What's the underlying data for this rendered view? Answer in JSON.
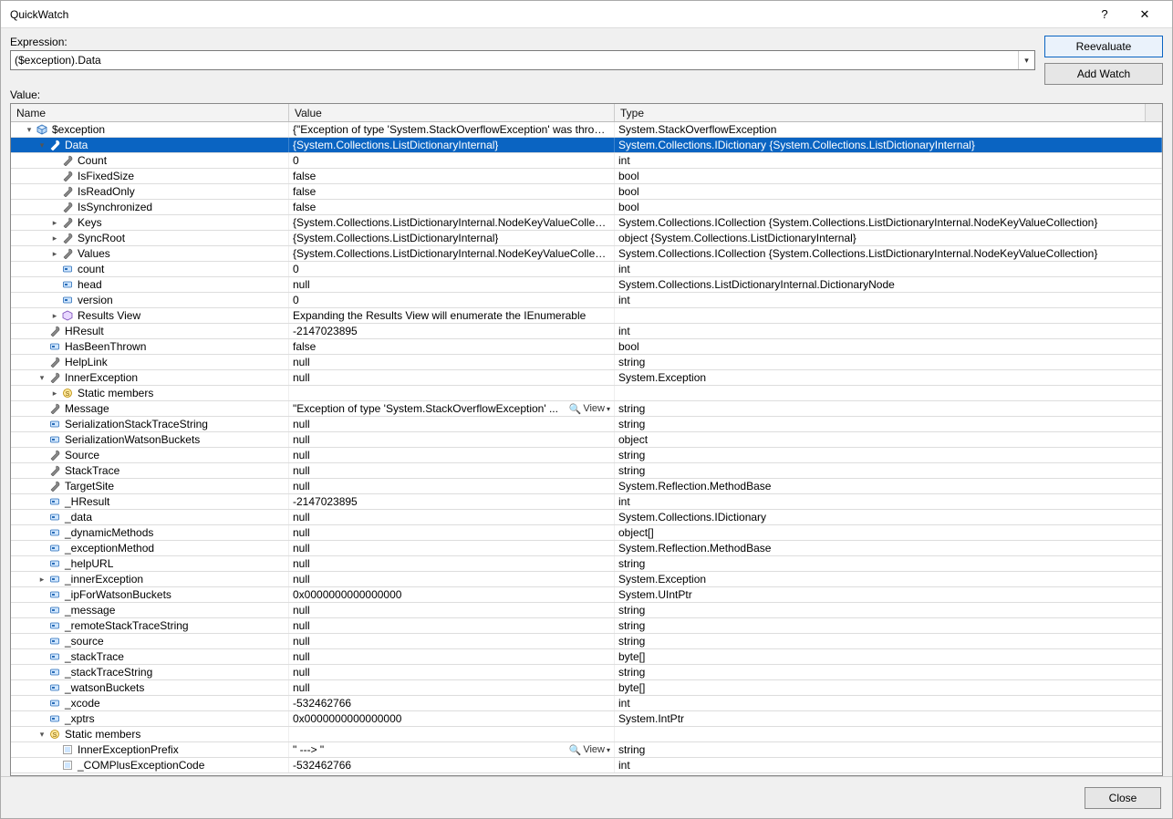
{
  "window": {
    "title": "QuickWatch",
    "help_btn": "?",
    "close_btn": "✕"
  },
  "labels": {
    "expression": "Expression:",
    "value": "Value:"
  },
  "expression": {
    "text": "($exception).Data"
  },
  "buttons": {
    "reevaluate": "Reevaluate",
    "add_watch": "Add Watch",
    "close": "Close"
  },
  "columns": {
    "name": "Name",
    "value": "Value",
    "type": "Type"
  },
  "visualizer": {
    "view_label": "View"
  },
  "rows": [
    {
      "depth": 1,
      "expander": "open",
      "icon": "cube",
      "name": "$exception",
      "value": "{\"Exception of type 'System.StackOverflowException' was thrown...",
      "type": "System.StackOverflowException",
      "selected": false
    },
    {
      "depth": 2,
      "expander": "open",
      "icon": "wrench",
      "name": "Data",
      "value": "{System.Collections.ListDictionaryInternal}",
      "type": "System.Collections.IDictionary {System.Collections.ListDictionaryInternal}",
      "selected": true
    },
    {
      "depth": 3,
      "expander": "none",
      "icon": "wrench",
      "name": "Count",
      "value": "0",
      "type": "int"
    },
    {
      "depth": 3,
      "expander": "none",
      "icon": "wrench",
      "name": "IsFixedSize",
      "value": "false",
      "type": "bool"
    },
    {
      "depth": 3,
      "expander": "none",
      "icon": "wrench",
      "name": "IsReadOnly",
      "value": "false",
      "type": "bool"
    },
    {
      "depth": 3,
      "expander": "none",
      "icon": "wrench",
      "name": "IsSynchronized",
      "value": "false",
      "type": "bool"
    },
    {
      "depth": 3,
      "expander": "closed",
      "icon": "wrench",
      "name": "Keys",
      "value": "{System.Collections.ListDictionaryInternal.NodeKeyValueCollecti...",
      "type": "System.Collections.ICollection {System.Collections.ListDictionaryInternal.NodeKeyValueCollection}"
    },
    {
      "depth": 3,
      "expander": "closed",
      "icon": "wrench",
      "name": "SyncRoot",
      "value": "{System.Collections.ListDictionaryInternal}",
      "type": "object {System.Collections.ListDictionaryInternal}"
    },
    {
      "depth": 3,
      "expander": "closed",
      "icon": "wrench",
      "name": "Values",
      "value": "{System.Collections.ListDictionaryInternal.NodeKeyValueCollecti...",
      "type": "System.Collections.ICollection {System.Collections.ListDictionaryInternal.NodeKeyValueCollection}"
    },
    {
      "depth": 3,
      "expander": "none",
      "icon": "field",
      "name": "count",
      "value": "0",
      "type": "int"
    },
    {
      "depth": 3,
      "expander": "none",
      "icon": "field",
      "name": "head",
      "value": "null",
      "type": "System.Collections.ListDictionaryInternal.DictionaryNode"
    },
    {
      "depth": 3,
      "expander": "none",
      "icon": "field",
      "name": "version",
      "value": "0",
      "type": "int"
    },
    {
      "depth": 3,
      "expander": "closed",
      "icon": "results",
      "name": "Results View",
      "value": "Expanding the Results View will enumerate the IEnumerable",
      "type": ""
    },
    {
      "depth": 2,
      "expander": "none",
      "icon": "wrench",
      "name": "HResult",
      "value": "-2147023895",
      "type": "int"
    },
    {
      "depth": 2,
      "expander": "none",
      "icon": "field",
      "name": "HasBeenThrown",
      "value": "false",
      "type": "bool"
    },
    {
      "depth": 2,
      "expander": "none",
      "icon": "wrench",
      "name": "HelpLink",
      "value": "null",
      "type": "string"
    },
    {
      "depth": 2,
      "expander": "open",
      "icon": "wrench",
      "name": "InnerException",
      "value": "null",
      "type": "System.Exception"
    },
    {
      "depth": 3,
      "expander": "closed",
      "icon": "static",
      "name": "Static members",
      "value": "",
      "type": ""
    },
    {
      "depth": 2,
      "expander": "none",
      "icon": "wrench",
      "name": "Message",
      "value": "\"Exception of type 'System.StackOverflowException' ...",
      "type": "string",
      "hasViewer": true
    },
    {
      "depth": 2,
      "expander": "none",
      "icon": "field",
      "name": "SerializationStackTraceString",
      "value": "null",
      "type": "string"
    },
    {
      "depth": 2,
      "expander": "none",
      "icon": "field",
      "name": "SerializationWatsonBuckets",
      "value": "null",
      "type": "object"
    },
    {
      "depth": 2,
      "expander": "none",
      "icon": "wrench",
      "name": "Source",
      "value": "null",
      "type": "string"
    },
    {
      "depth": 2,
      "expander": "none",
      "icon": "wrench",
      "name": "StackTrace",
      "value": "null",
      "type": "string"
    },
    {
      "depth": 2,
      "expander": "none",
      "icon": "wrench",
      "name": "TargetSite",
      "value": "null",
      "type": "System.Reflection.MethodBase"
    },
    {
      "depth": 2,
      "expander": "none",
      "icon": "field",
      "name": "_HResult",
      "value": "-2147023895",
      "type": "int"
    },
    {
      "depth": 2,
      "expander": "none",
      "icon": "field",
      "name": "_data",
      "value": "null",
      "type": "System.Collections.IDictionary"
    },
    {
      "depth": 2,
      "expander": "none",
      "icon": "field",
      "name": "_dynamicMethods",
      "value": "null",
      "type": "object[]"
    },
    {
      "depth": 2,
      "expander": "none",
      "icon": "field",
      "name": "_exceptionMethod",
      "value": "null",
      "type": "System.Reflection.MethodBase"
    },
    {
      "depth": 2,
      "expander": "none",
      "icon": "field",
      "name": "_helpURL",
      "value": "null",
      "type": "string"
    },
    {
      "depth": 2,
      "expander": "closed",
      "icon": "field",
      "name": "_innerException",
      "value": "null",
      "type": "System.Exception"
    },
    {
      "depth": 2,
      "expander": "none",
      "icon": "field",
      "name": "_ipForWatsonBuckets",
      "value": "0x0000000000000000",
      "type": "System.UIntPtr"
    },
    {
      "depth": 2,
      "expander": "none",
      "icon": "field",
      "name": "_message",
      "value": "null",
      "type": "string"
    },
    {
      "depth": 2,
      "expander": "none",
      "icon": "field",
      "name": "_remoteStackTraceString",
      "value": "null",
      "type": "string"
    },
    {
      "depth": 2,
      "expander": "none",
      "icon": "field",
      "name": "_source",
      "value": "null",
      "type": "string"
    },
    {
      "depth": 2,
      "expander": "none",
      "icon": "field",
      "name": "_stackTrace",
      "value": "null",
      "type": "byte[]"
    },
    {
      "depth": 2,
      "expander": "none",
      "icon": "field",
      "name": "_stackTraceString",
      "value": "null",
      "type": "string"
    },
    {
      "depth": 2,
      "expander": "none",
      "icon": "field",
      "name": "_watsonBuckets",
      "value": "null",
      "type": "byte[]"
    },
    {
      "depth": 2,
      "expander": "none",
      "icon": "field",
      "name": "_xcode",
      "value": "-532462766",
      "type": "int"
    },
    {
      "depth": 2,
      "expander": "none",
      "icon": "field",
      "name": "_xptrs",
      "value": "0x0000000000000000",
      "type": "System.IntPtr"
    },
    {
      "depth": 2,
      "expander": "open",
      "icon": "static",
      "name": "Static members",
      "value": "",
      "type": ""
    },
    {
      "depth": 3,
      "expander": "none",
      "icon": "const",
      "name": "InnerExceptionPrefix",
      "value": "\" ---> \"",
      "type": "string",
      "hasViewer": true
    },
    {
      "depth": 3,
      "expander": "none",
      "icon": "const",
      "name": "_COMPlusExceptionCode",
      "value": "-532462766",
      "type": "int"
    }
  ]
}
